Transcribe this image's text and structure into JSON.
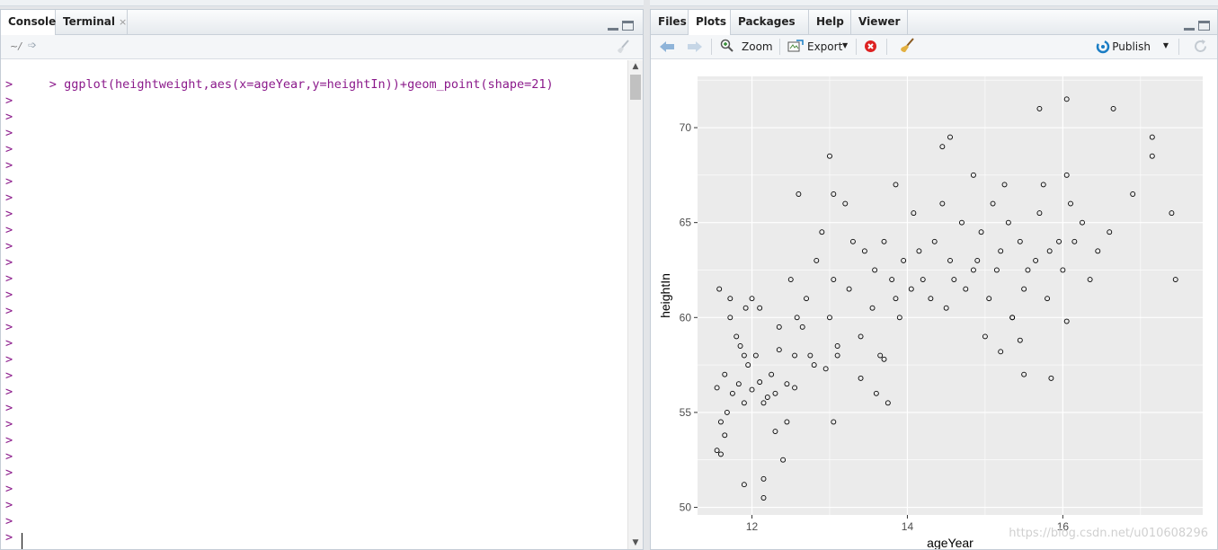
{
  "console_pane": {
    "tabs": [
      {
        "label": "Console",
        "active": true
      },
      {
        "label": "Terminal",
        "close": "×"
      }
    ],
    "path": "~/",
    "prompt": ">",
    "command": "ggplot(heightweight,aes(x=ageYear,y=heightIn))+geom_point(shape=21)",
    "empty_prompt_count": 29
  },
  "plot_pane": {
    "tabs": [
      {
        "label": "Files"
      },
      {
        "label": "Plots",
        "active": true
      },
      {
        "label": "Packages"
      },
      {
        "label": "Help"
      },
      {
        "label": "Viewer"
      }
    ],
    "toolbar": {
      "zoom_label": "Zoom",
      "export_label": "Export",
      "publish_label": "Publish"
    },
    "watermark": "https://blog.csdn.net/u010608296"
  },
  "colors": {
    "plot_panel_bg": "#ebebeb",
    "prompt_color": "#8b1a8b",
    "accent_blue": "#1a7dc4"
  },
  "chart_data": {
    "type": "scatter",
    "xlabel": "ageYear",
    "ylabel": "heightIn",
    "xlim": [
      11.3,
      17.8
    ],
    "ylim": [
      49.6,
      72.7
    ],
    "x_ticks": [
      12,
      14,
      16
    ],
    "y_ticks": [
      50,
      55,
      60,
      65,
      70
    ],
    "grid": true,
    "marker": "open circle (shape=21)",
    "points": [
      [
        11.55,
        56.3
      ],
      [
        11.72,
        60.0
      ],
      [
        11.55,
        53.0
      ],
      [
        11.68,
        55.0
      ],
      [
        11.58,
        61.5
      ],
      [
        11.65,
        57.0
      ],
      [
        11.8,
        59.0
      ],
      [
        11.95,
        57.5
      ],
      [
        11.72,
        61.0
      ],
      [
        11.9,
        58.0
      ],
      [
        11.83,
        56.5
      ],
      [
        11.92,
        60.5
      ],
      [
        12.0,
        61.0
      ],
      [
        12.1,
        60.5
      ],
      [
        12.05,
        58.0
      ],
      [
        12.25,
        57.0
      ],
      [
        12.35,
        59.5
      ],
      [
        12.5,
        62.0
      ],
      [
        12.58,
        60.0
      ],
      [
        12.7,
        61.0
      ],
      [
        12.83,
        63.0
      ],
      [
        12.9,
        64.5
      ],
      [
        13.05,
        62.0
      ],
      [
        13.2,
        66.0
      ],
      [
        13.3,
        64.0
      ],
      [
        13.45,
        63.5
      ],
      [
        13.58,
        62.5
      ],
      [
        13.7,
        64.0
      ],
      [
        13.85,
        61.0
      ],
      [
        13.95,
        63.0
      ],
      [
        14.08,
        65.5
      ],
      [
        14.2,
        62.0
      ],
      [
        14.35,
        64.0
      ],
      [
        14.45,
        66.0
      ],
      [
        14.55,
        63.0
      ],
      [
        14.7,
        65.0
      ],
      [
        14.85,
        62.5
      ],
      [
        14.95,
        64.5
      ],
      [
        15.1,
        66.0
      ],
      [
        15.2,
        63.5
      ],
      [
        15.3,
        65.0
      ],
      [
        15.45,
        64.0
      ],
      [
        15.55,
        62.5
      ],
      [
        15.7,
        65.5
      ],
      [
        15.83,
        63.5
      ],
      [
        15.95,
        64.0
      ],
      [
        16.1,
        66.0
      ],
      [
        16.25,
        65.0
      ],
      [
        16.35,
        62.0
      ],
      [
        16.6,
        64.5
      ],
      [
        11.6,
        54.5
      ],
      [
        11.75,
        56.0
      ],
      [
        11.85,
        58.5
      ],
      [
        12.15,
        55.5
      ],
      [
        12.3,
        54.0
      ],
      [
        12.45,
        56.5
      ],
      [
        12.55,
        58.0
      ],
      [
        12.65,
        59.5
      ],
      [
        12.8,
        57.5
      ],
      [
        13.0,
        60.0
      ],
      [
        13.1,
        58.5
      ],
      [
        13.25,
        61.5
      ],
      [
        13.4,
        59.0
      ],
      [
        13.55,
        60.5
      ],
      [
        13.65,
        58.0
      ],
      [
        13.8,
        62.0
      ],
      [
        13.9,
        60.0
      ],
      [
        14.05,
        61.5
      ],
      [
        14.15,
        63.5
      ],
      [
        14.3,
        61.0
      ],
      [
        14.5,
        60.5
      ],
      [
        14.6,
        62.0
      ],
      [
        14.75,
        61.5
      ],
      [
        14.9,
        63.0
      ],
      [
        15.05,
        61.0
      ],
      [
        15.15,
        62.5
      ],
      [
        15.35,
        60.0
      ],
      [
        15.5,
        61.5
      ],
      [
        15.65,
        63.0
      ],
      [
        15.8,
        61.0
      ],
      [
        16.0,
        62.5
      ],
      [
        16.15,
        64.0
      ],
      [
        16.45,
        63.5
      ],
      [
        16.9,
        66.5
      ],
      [
        17.15,
        68.5
      ],
      [
        17.4,
        65.5
      ],
      [
        17.45,
        62.0
      ],
      [
        16.05,
        71.5
      ],
      [
        16.65,
        71.0
      ],
      [
        15.7,
        71.0
      ],
      [
        14.55,
        69.5
      ],
      [
        14.45,
        69.0
      ],
      [
        13.0,
        68.5
      ],
      [
        13.05,
        66.5
      ],
      [
        12.6,
        66.5
      ],
      [
        13.85,
        67.0
      ],
      [
        14.85,
        67.5
      ],
      [
        15.25,
        67.0
      ],
      [
        15.75,
        67.0
      ],
      [
        16.05,
        67.5
      ],
      [
        17.15,
        69.5
      ],
      [
        12.15,
        50.5
      ],
      [
        12.15,
        51.5
      ],
      [
        11.9,
        51.2
      ],
      [
        12.4,
        52.5
      ],
      [
        11.6,
        52.8
      ],
      [
        11.65,
        53.8
      ],
      [
        12.45,
        54.5
      ],
      [
        13.05,
        54.5
      ],
      [
        13.75,
        55.5
      ],
      [
        13.6,
        56.0
      ],
      [
        13.4,
        56.8
      ],
      [
        15.5,
        57.0
      ],
      [
        15.85,
        56.8
      ],
      [
        15.2,
        58.2
      ],
      [
        15.45,
        58.8
      ],
      [
        15.35,
        60.0
      ],
      [
        16.05,
        59.8
      ],
      [
        15.0,
        59.0
      ],
      [
        13.7,
        57.8
      ],
      [
        13.1,
        58.0
      ],
      [
        12.95,
        57.3
      ],
      [
        12.75,
        58.0
      ],
      [
        12.35,
        58.3
      ],
      [
        12.0,
        56.2
      ],
      [
        11.9,
        55.5
      ],
      [
        12.2,
        55.8
      ],
      [
        12.1,
        56.6
      ],
      [
        12.3,
        56.0
      ],
      [
        12.55,
        56.3
      ]
    ]
  }
}
